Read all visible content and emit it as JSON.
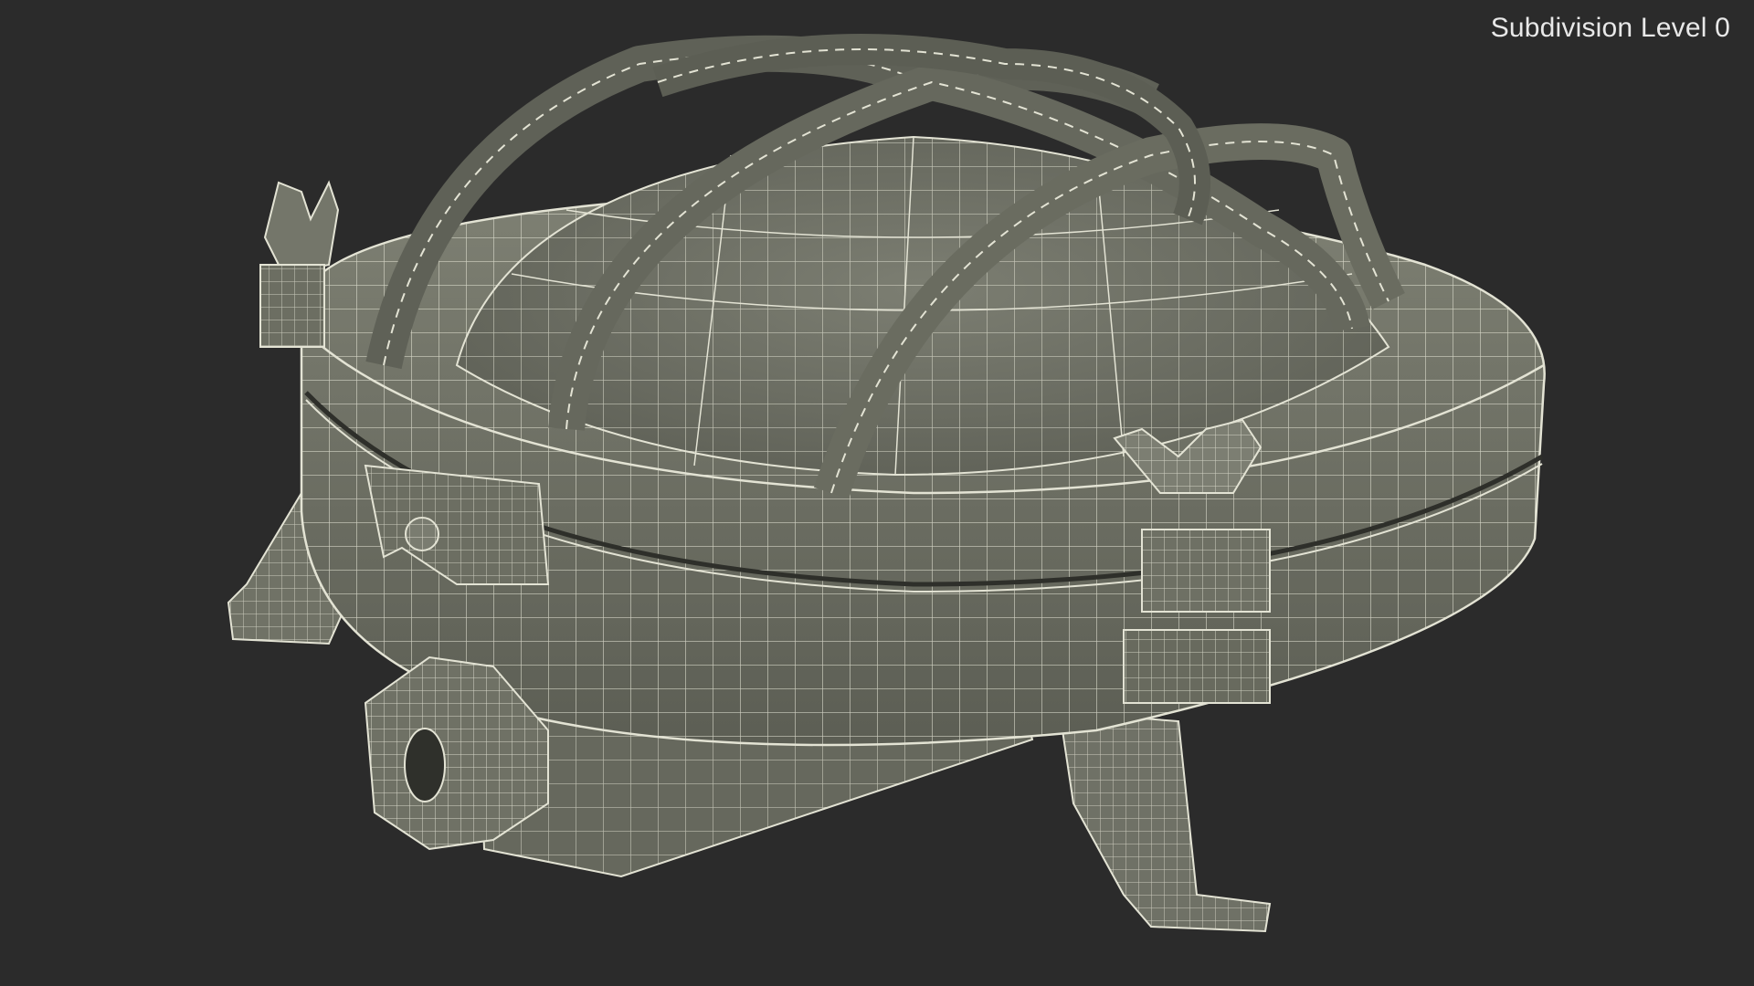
{
  "viewport": {
    "overlay_label": "Subdivision Level 0",
    "background_color": "#2b2b2b"
  },
  "model": {
    "subject": "wireframe-lamp-fixture",
    "surface_color": "#7b7d70",
    "wire_color": "#e6e6d8"
  }
}
